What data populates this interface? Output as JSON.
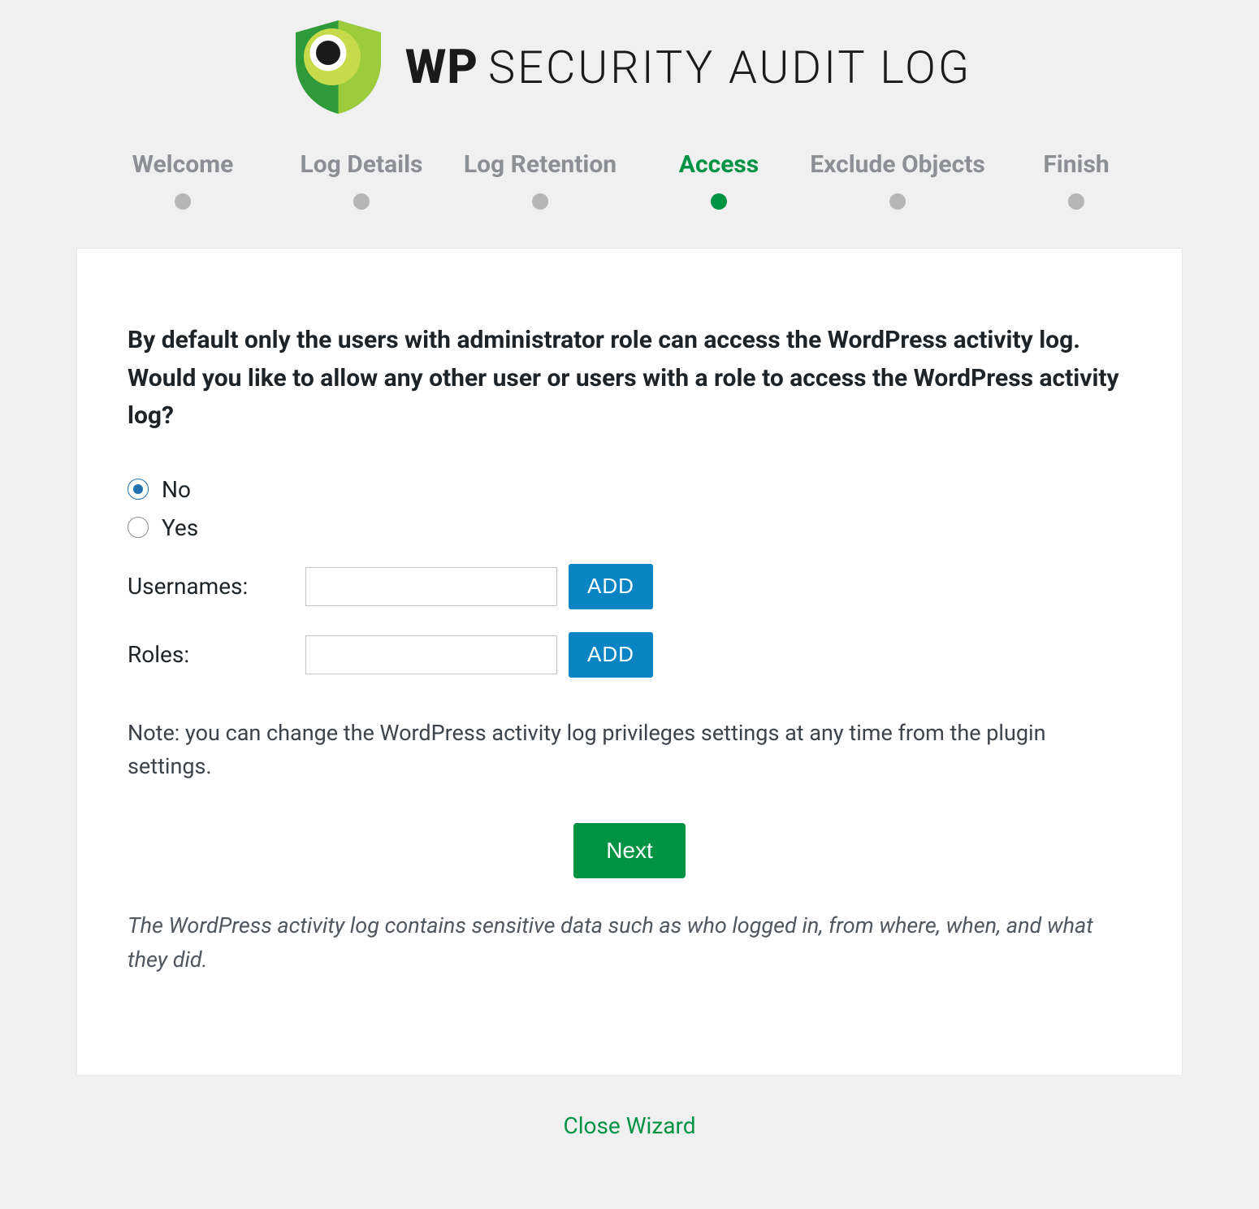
{
  "brand": {
    "wp": "WP",
    "rest": "SECURITY AUDIT LOG"
  },
  "steps": [
    {
      "label": "Welcome",
      "active": false
    },
    {
      "label": "Log Details",
      "active": false
    },
    {
      "label": "Log Retention",
      "active": false
    },
    {
      "label": "Access",
      "active": true
    },
    {
      "label": "Exclude Objects",
      "active": false
    },
    {
      "label": "Finish",
      "active": false
    }
  ],
  "main": {
    "question": "By default only the users with administrator role can access the WordPress activity log. Would you like to allow any other user or users with a role to access the WordPress activity log?",
    "options": {
      "no": "No",
      "yes": "Yes",
      "selected": "no"
    },
    "usernames_label": "Usernames:",
    "roles_label": "Roles:",
    "add_label": "ADD",
    "usernames_value": "",
    "roles_value": "",
    "note": "Note: you can change the WordPress activity log privileges settings at any time from the plugin settings.",
    "next_label": "Next",
    "disclaimer": "The WordPress activity log contains sensitive data such as who logged in, from where, when, and what they did."
  },
  "footer": {
    "close_label": "Close Wizard"
  }
}
